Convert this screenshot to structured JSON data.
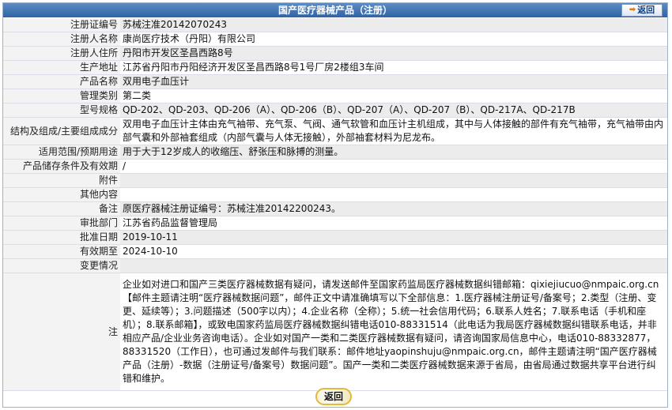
{
  "header": {
    "title": "国产医疗器械产品（注册）",
    "back_label": "返回"
  },
  "rows": [
    {
      "label": "注册证编号",
      "value": "苏械注准20142070243"
    },
    {
      "label": "注册人名称",
      "value": "康尚医疗技术（丹阳）有限公司"
    },
    {
      "label": "注册人住所",
      "value": "丹阳市开发区圣昌西路8号"
    },
    {
      "label": "生产地址",
      "value": "江苏省丹阳市丹阳经济开发区圣昌西路8号1号厂房2楼组3车间"
    },
    {
      "label": "产品名称",
      "value": "双用电子血压计"
    },
    {
      "label": "管理类别",
      "value": "第二类"
    },
    {
      "label": "型号规格",
      "value": "QD-202、QD-203、QD-206（A）、QD-206（B）、QD-207（A）、QD-207（B）、QD-217A、QD-217B"
    },
    {
      "label": "结构及组成/主要组成成分",
      "value": "双用电子血压计主体由充气袖带、充气泵、气阀、通气软管和血压计主机组成，其中与人体接触的部件有充气袖带，充气袖带由内部气囊和外部袖套组成（内部气囊与人体无接触），外部袖套材料为尼龙布。"
    },
    {
      "label": "适用范围/预期用途",
      "value": "用于大于12岁成人的收缩压、舒张压和脉搏的测量。"
    },
    {
      "label": "产品储存条件及有效期",
      "value": "/"
    },
    {
      "label": "附件",
      "value": ""
    },
    {
      "label": "其他内容",
      "value": ""
    },
    {
      "label": "备注",
      "value": "原医疗器械注册证编号：苏械注准20142200243。"
    },
    {
      "label": "审批部门",
      "value": "江苏省药品监督管理局"
    },
    {
      "label": "批准日期",
      "value": "2019-10-11"
    },
    {
      "label": "有效期至",
      "value": "2024-10-10"
    },
    {
      "label": "变更情况",
      "value": ""
    }
  ],
  "note": {
    "label": "注",
    "text": "企业如对进口和国产三类医疗器械数据有疑问，请发送邮件至国家药监局医疗器械数据纠错邮箱：qixiejiucuo@nmpaic.org.cn【邮件主题请注明“医疗器械数据问题”，邮件正文中请准确填写以下全部信息：1.医疗器械注册证号/备案号；2.类型（注册、变更、延续等）；3.问题描述（500字以内）；4.企业名称（全称）；5.统一社会信用代码；6.联系人姓名；7.联系电话（手机和座机）；8.联系邮箱】，或致电国家药监局医疗器械数据纠错电话010-88331514（此电话为我局医疗器械数据纠错联系电话，并非相应产品/企业业务咨询电话）。企业如对国产一类和二类医疗器械数据有疑问，请咨询国家局信息中心，电话010-88332877，88331520（工作日），也可通过发邮件与我们联系：邮件地址yaopinshuju@nmpaic.org.cn，邮件主题请注明“国产医疗器械产品（注册）-数据（注册证号/备案号）数据问题”。国产一类和二类医疗器械数据来源于省局，由省局通过数据共享平台进行纠错和维护。"
  },
  "footer": {
    "back_label": "返回"
  }
}
